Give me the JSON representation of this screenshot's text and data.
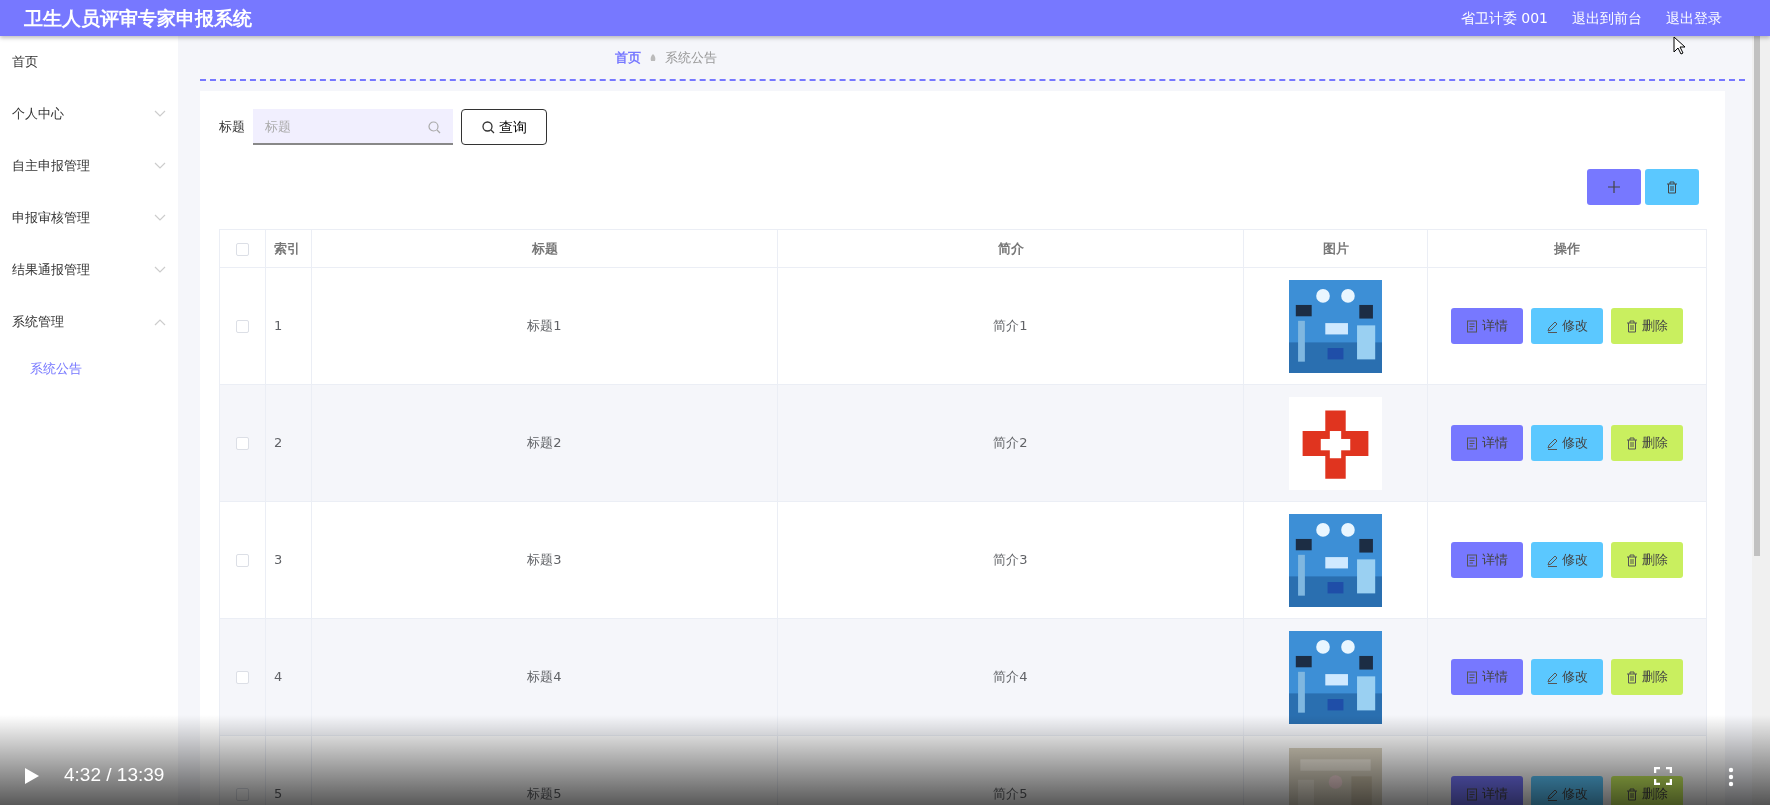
{
  "window": {
    "title": "卫生人员评审专家申报系统"
  },
  "header_links": [
    "省卫计委 001",
    "退出到前台",
    "退出登录"
  ],
  "sidebar": {
    "items": [
      {
        "label": "首页",
        "kind": "link"
      },
      {
        "label": "个人中心",
        "kind": "menu",
        "expanded": false
      },
      {
        "label": "自主申报管理",
        "kind": "menu",
        "expanded": false
      },
      {
        "label": "申报审核管理",
        "kind": "menu",
        "expanded": false
      },
      {
        "label": "结果通报管理",
        "kind": "menu",
        "expanded": false
      },
      {
        "label": "系统管理",
        "kind": "menu",
        "expanded": true,
        "children": [
          {
            "label": "系统公告",
            "selected": true
          }
        ]
      }
    ]
  },
  "breadcrumb": [
    "首页",
    "系统公告"
  ],
  "search": {
    "label": "标题",
    "placeholder": "标题",
    "button": "查询"
  },
  "table": {
    "header_checked": false,
    "columns": [
      "索引",
      "标题",
      "简介",
      "图片",
      "操作"
    ],
    "rows": [
      {
        "checked": false,
        "index": "1",
        "title": "标题1",
        "intro": "简介1",
        "actions": [
          "详情",
          "修改",
          "删除"
        ]
      },
      {
        "checked": false,
        "index": "2",
        "title": "标题2",
        "intro": "简介2",
        "actions": [
          "详情",
          "修改",
          "删除"
        ]
      },
      {
        "checked": false,
        "index": "3",
        "title": "标题3",
        "intro": "简介3",
        "actions": [
          "详情",
          "修改",
          "删除"
        ]
      },
      {
        "checked": false,
        "index": "4",
        "title": "标题4",
        "intro": "简介4",
        "actions": [
          "详情",
          "修改",
          "删除"
        ]
      },
      {
        "checked": false,
        "index": "5",
        "title": "标题5",
        "intro": "简介5",
        "actions": [
          "详情",
          "修改",
          "删除"
        ]
      }
    ]
  },
  "player": {
    "time": "4:32 / 13:39"
  }
}
